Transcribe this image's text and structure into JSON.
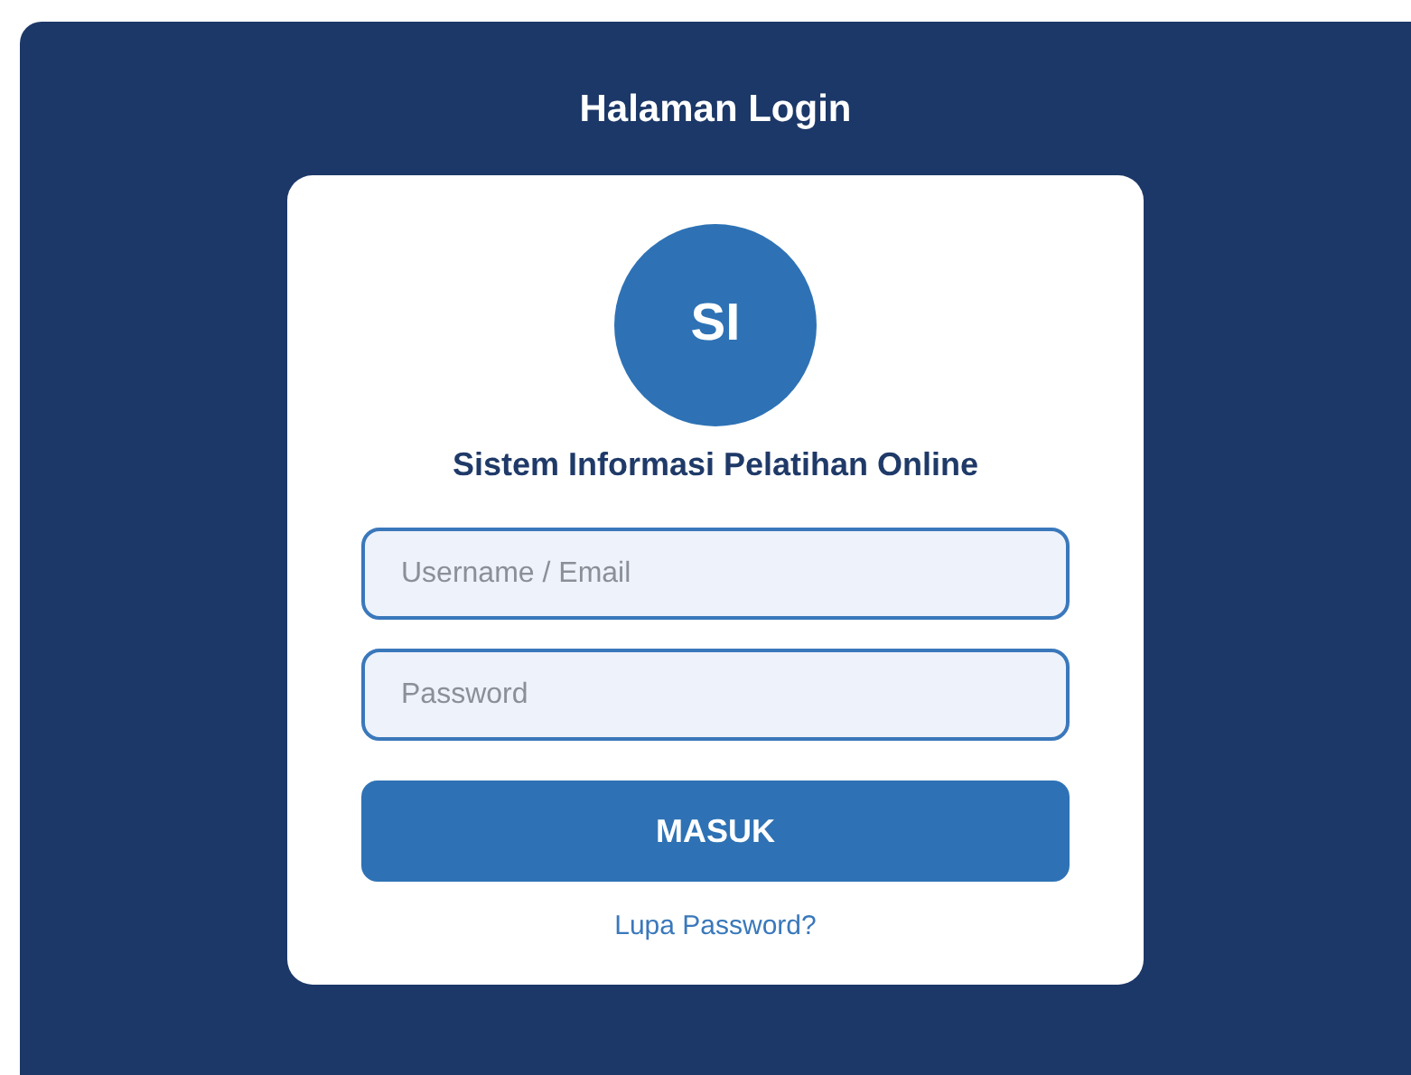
{
  "page_title": "Halaman Login",
  "logo": {
    "text": "SI"
  },
  "app_name": "Sistem Informasi Pelatihan Online",
  "fields": [
    {
      "placeholder": "Username / Email"
    },
    {
      "placeholder": "Password"
    }
  ],
  "submit_button": "MASUK",
  "forgot_link": "Lupa Password?"
}
